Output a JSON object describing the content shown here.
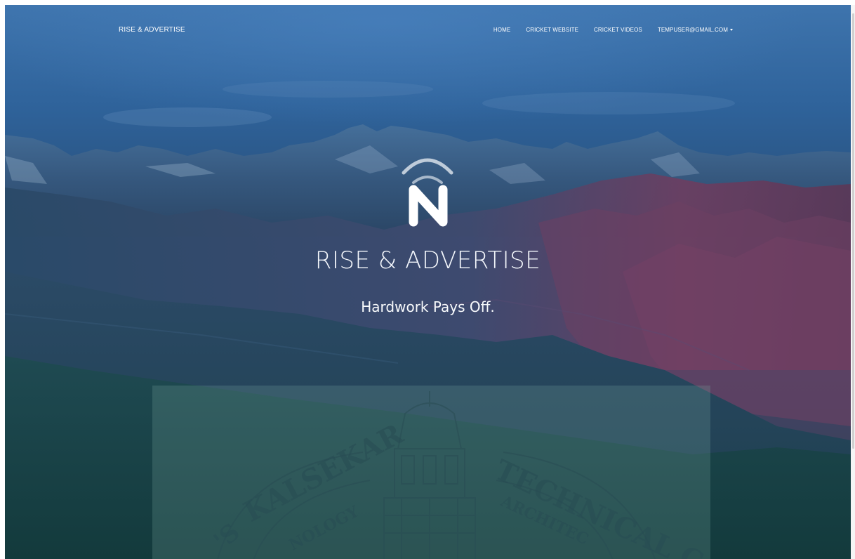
{
  "navbar": {
    "brand": "RISE & ADVERTISE",
    "items": [
      {
        "label": "HOME"
      },
      {
        "label": "CRICKET WEBSITE"
      },
      {
        "label": "CRICKET VIDEOS"
      },
      {
        "label": "TEMPUSER@GMAIL.COM",
        "dropdown": true
      }
    ]
  },
  "hero": {
    "title": "RISE & ADVERTISE",
    "subtitle": "Hardwork Pays Off."
  },
  "seal": {
    "text_left": "KALSEKAR",
    "text_right": "TECHNICAL C",
    "text_lower_left": "NOLOGY",
    "text_lower_right": "ARCHITEC",
    "prefix": "'S"
  },
  "colors": {
    "sky_top": "#386ea8",
    "sky_mid": "#2c5c8c",
    "mountain_dark": "#24486e",
    "mountain_purple": "#6a3f62",
    "valley": "#1c4b4d",
    "panel_overlay": "#78a8a0"
  },
  "icons": {
    "logo": "n-signal-logo-icon",
    "dropdown": "caret-down-icon"
  }
}
